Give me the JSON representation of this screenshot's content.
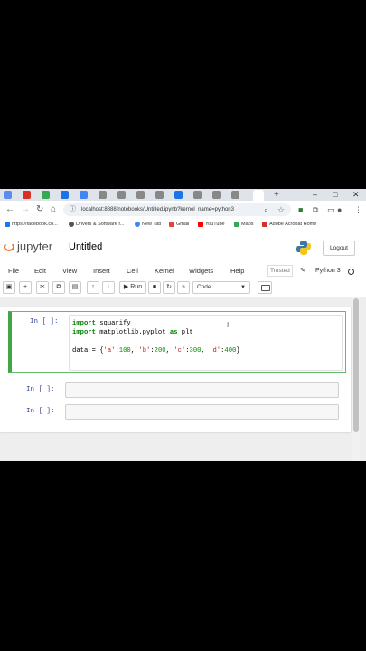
{
  "browser": {
    "url": "localhost:8888/notebooks/Untitled.ipynb?kernel_name=python3",
    "tab_new_label": "+",
    "window_controls": [
      "–",
      "□",
      "✕"
    ],
    "bookmarks": [
      {
        "label": "https://facebook.co...",
        "color": "#1877f2"
      },
      {
        "label": "Drivers & Software f...",
        "color": "#555555"
      },
      {
        "label": "New Tab",
        "color": "#4285f4"
      },
      {
        "label": "Gmail",
        "color": "#ea4335"
      },
      {
        "label": "YouTube",
        "color": "#ff0000"
      },
      {
        "label": "Maps",
        "color": "#34a853"
      },
      {
        "label": "Adobe Acrobat Home",
        "color": "#d32f2f"
      }
    ]
  },
  "jupyter": {
    "logo_text": "jupyter",
    "notebook_title": "Untitled",
    "logout_label": "Logout",
    "menu": [
      "File",
      "Edit",
      "View",
      "Insert",
      "Cell",
      "Kernel",
      "Widgets",
      "Help"
    ],
    "trusted_label": "Trusted",
    "kernel_name": "Python 3",
    "toolbar": {
      "run_label": "Run",
      "cell_type": "Code"
    }
  },
  "cells": [
    {
      "prompt": "In [ ]:",
      "lines": [
        "import squarify",
        "import matplotlib.pyplot as plt",
        "",
        "data = {'a':100, 'b':200, 'c':300, 'd':400}"
      ]
    },
    {
      "prompt": "In [ ]:",
      "lines": []
    },
    {
      "prompt": "In [ ]:",
      "lines": []
    }
  ]
}
